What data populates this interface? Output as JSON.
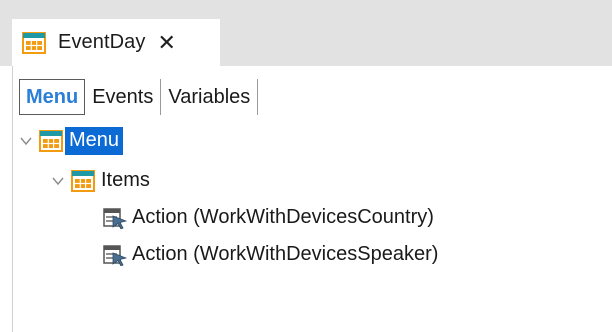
{
  "document_tab": {
    "title": "EventDay",
    "close_glyph": "✕",
    "icon": "menu-grid-icon"
  },
  "subtabs": [
    {
      "label": "Menu",
      "active": true
    },
    {
      "label": "Events",
      "active": false
    },
    {
      "label": "Variables",
      "active": false
    }
  ],
  "tree": {
    "root": {
      "label": "Menu",
      "icon": "menu-grid-icon",
      "expanded": true,
      "selected": true
    },
    "items": {
      "label": "Items",
      "icon": "menu-grid-icon",
      "expanded": true
    },
    "actions": [
      {
        "label": "Action (WorkWithDevicesCountry)",
        "icon": "action-panel-icon"
      },
      {
        "label": "Action (WorkWithDevicesSpeaker)",
        "icon": "action-panel-icon"
      }
    ]
  },
  "colors": {
    "accent": "#2b7fd8",
    "selection": "#0b6ad4",
    "icon_orange": "#f39c12",
    "icon_teal": "#1f9aa5"
  }
}
